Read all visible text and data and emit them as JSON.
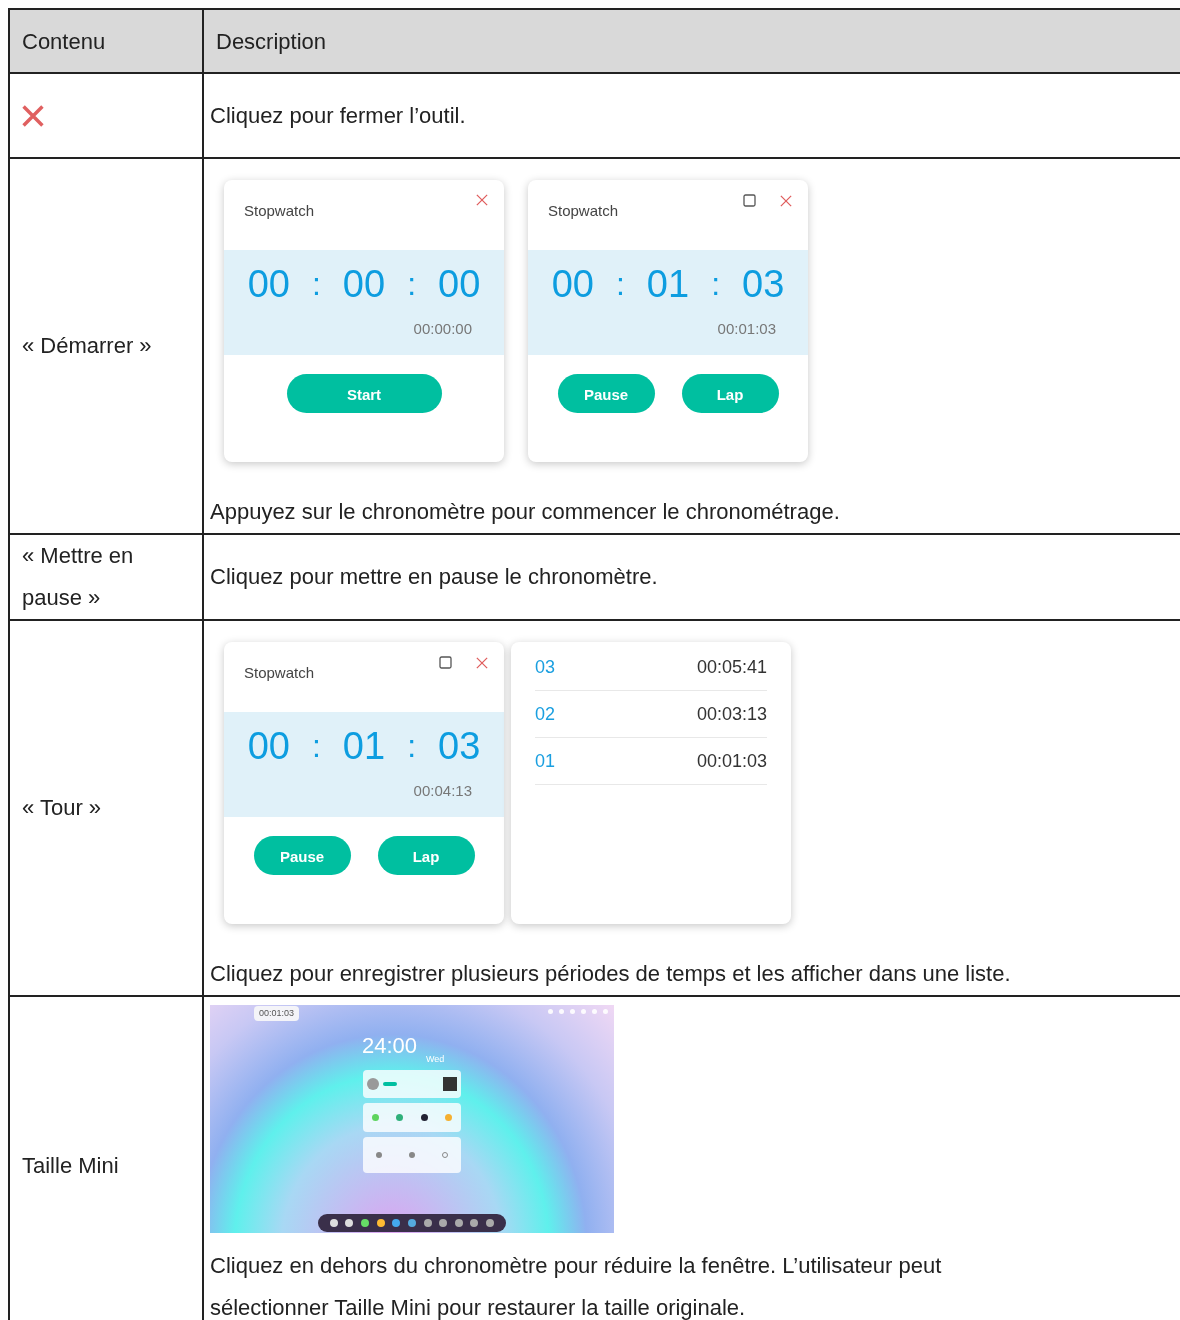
{
  "table": {
    "columns": [
      "Contenu",
      "Description"
    ],
    "rows": [
      {
        "kind": "icon",
        "content": "",
        "figures": [],
        "text": "Cliquez pour fermer l’outil."
      },
      {
        "kind": "text",
        "content": "« Démarrer »",
        "figures": [
          {
            "kind": "stopwatch",
            "title": "Stopwatch",
            "maximize": false,
            "digits": [
              "00",
              "00",
              "00"
            ],
            "separator": ":",
            "total": "00:00:00",
            "buttons": [
              "Start"
            ]
          },
          {
            "kind": "stopwatch",
            "title": "Stopwatch",
            "maximize": true,
            "digits": [
              "00",
              "01",
              "03"
            ],
            "separator": ":",
            "total": "00:01:03",
            "buttons": [
              "Pause",
              "Lap"
            ]
          }
        ],
        "text": "Appuyez sur le chronomètre pour commencer le chronométrage."
      },
      {
        "kind": "text",
        "content": "« Mettre en pause »",
        "figures": [],
        "text": "Cliquez pour mettre en pause le chronomètre."
      },
      {
        "kind": "text",
        "content": "« Tour »",
        "figures": [
          {
            "kind": "stopwatch",
            "title": "Stopwatch",
            "maximize": true,
            "digits": [
              "00",
              "01",
              "03"
            ],
            "separator": ":",
            "total": "00:04:13",
            "buttons": [
              "Pause",
              "Lap"
            ]
          },
          {
            "kind": "laps",
            "laps": [
              {
                "number": "03",
                "time": "00:05:41"
              },
              {
                "number": "02",
                "time": "00:03:13"
              },
              {
                "number": "01",
                "time": "00:01:03"
              }
            ]
          }
        ],
        "text": "Cliquez pour enregistrer plusieurs périodes de temps et les afficher dans une liste."
      },
      {
        "kind": "text",
        "content": "Taille Mini",
        "figures": [
          {
            "kind": "desktop",
            "badge": "00:01:03",
            "clock": "24:00",
            "day": "Wed"
          }
        ],
        "text": "Cliquez en dehors du chronomètre pour réduire la fenêtre. L’utilisateur peut sélectionner Taille Mini pour restaurer la taille originale."
      }
    ]
  }
}
